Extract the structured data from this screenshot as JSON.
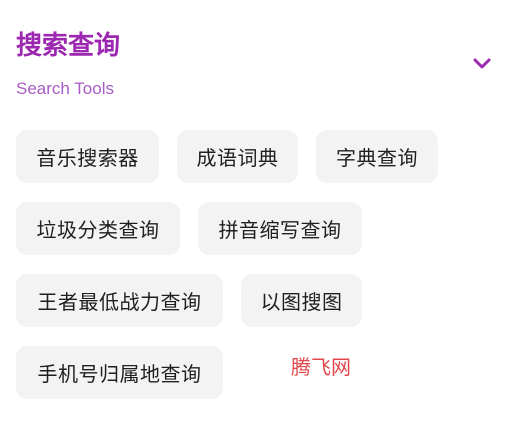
{
  "header": {
    "title": "搜索查询",
    "subtitle": "Search Tools",
    "toggle_icon": "chevron-down-icon"
  },
  "colors": {
    "accent": "#9C27B0",
    "subtitle": "#A85BC4",
    "chip_background": "#F3F3F4",
    "watermark": "#E0464A"
  },
  "tools": [
    {
      "label": "音乐搜索器"
    },
    {
      "label": "成语词典"
    },
    {
      "label": "字典查询"
    },
    {
      "label": "垃圾分类查询"
    },
    {
      "label": "拼音缩写查询"
    },
    {
      "label": "王者最低战力查询"
    },
    {
      "label": "以图搜图"
    },
    {
      "label": "手机号归属地查询"
    }
  ],
  "watermark": {
    "text": "腾飞网"
  }
}
